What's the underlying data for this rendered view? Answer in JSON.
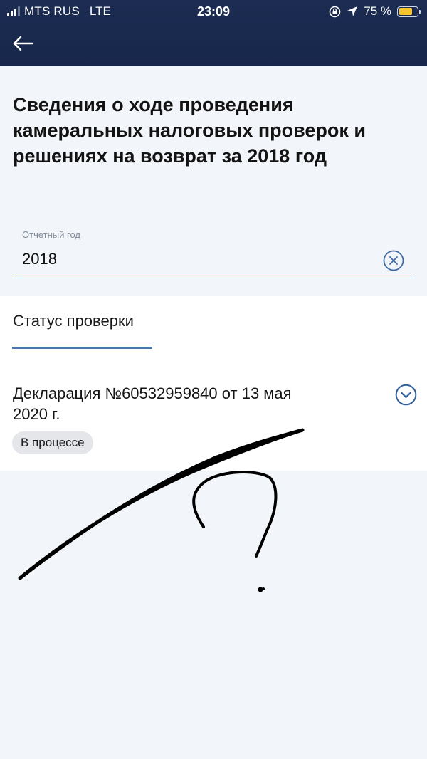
{
  "status_bar": {
    "carrier": "MTS RUS",
    "network": "LTE",
    "time": "23:09",
    "battery_text": "75 %",
    "battery_level": 0.75,
    "signal_bars_on": 3,
    "signal_bars_total": 4
  },
  "nav": {
    "back_icon": "arrow-left-icon"
  },
  "page": {
    "title": "Сведения о ходе проведения камеральных налоговых проверок и решениях на возврат за 2018 год"
  },
  "report_year_field": {
    "label": "Отчетный год",
    "value": "2018",
    "clear_icon": "close-circle-icon"
  },
  "tabs": [
    {
      "label": "Статус проверки",
      "active": true
    }
  ],
  "declaration": {
    "title": "Декларация №60532959840 от 13 мая 2020 г.",
    "status": "В процессе",
    "expand_icon": "chevron-down-circle-icon"
  },
  "colors": {
    "header_bg": "#1c2c52",
    "accent": "#4876ad",
    "badge_bg": "#e4e6ea",
    "page_bg": "#f2f5f9"
  }
}
